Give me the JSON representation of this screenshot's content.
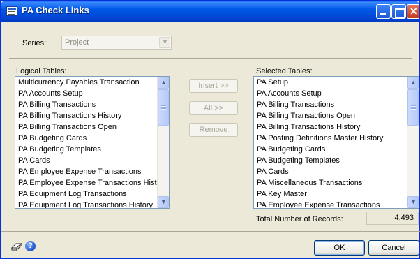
{
  "window": {
    "title": "PA Check Links"
  },
  "series": {
    "label": "Series:",
    "value": "Project"
  },
  "logical": {
    "label": "Logical Tables:",
    "items": [
      "Multicurrency Payables Transaction",
      "PA Accounts Setup",
      "PA Billing Transactions",
      "PA Billing Transactions History",
      "PA Billing Transactions Open",
      "PA Budgeting Cards",
      "PA Budgeting Templates",
      "PA Cards",
      "PA Employee Expense Transactions",
      "PA Employee Expense Transactions Histo",
      "PA Equipment Log Transactions",
      "PA Equipment Log Transactions History"
    ]
  },
  "buttons": {
    "insert": "Insert >>",
    "all": "All >>",
    "remove": "Remove",
    "ok": "OK",
    "cancel": "Cancel"
  },
  "selected": {
    "label": "Selected Tables:",
    "items": [
      "PA Setup",
      "PA Accounts Setup",
      "PA Billing Transactions",
      "PA Billing Transactions Open",
      "PA Billing Transactions History",
      "PA Posting Definitions Master History",
      "PA Budgeting Cards",
      "PA Budgeting Templates",
      "PA Cards",
      "PA Miscellaneous Transactions",
      "PA Key Master",
      "PA Employee Expense Transactions"
    ]
  },
  "total": {
    "label": "Total Number of Records:",
    "value": "4,493"
  },
  "icons": {
    "window": "window-icon",
    "minimize": "minimize-icon",
    "maximize": "maximize-icon",
    "close": "close-icon",
    "eraser": "eraser-icon",
    "help": "help-icon",
    "scroll_up": "scroll-up-icon",
    "scroll_down": "scroll-down-icon"
  },
  "colors": {
    "titlebar": "#0058e6",
    "dialog_bg": "#ece9d8",
    "list_border": "#7f9db9",
    "disabled_text": "#aca899"
  }
}
